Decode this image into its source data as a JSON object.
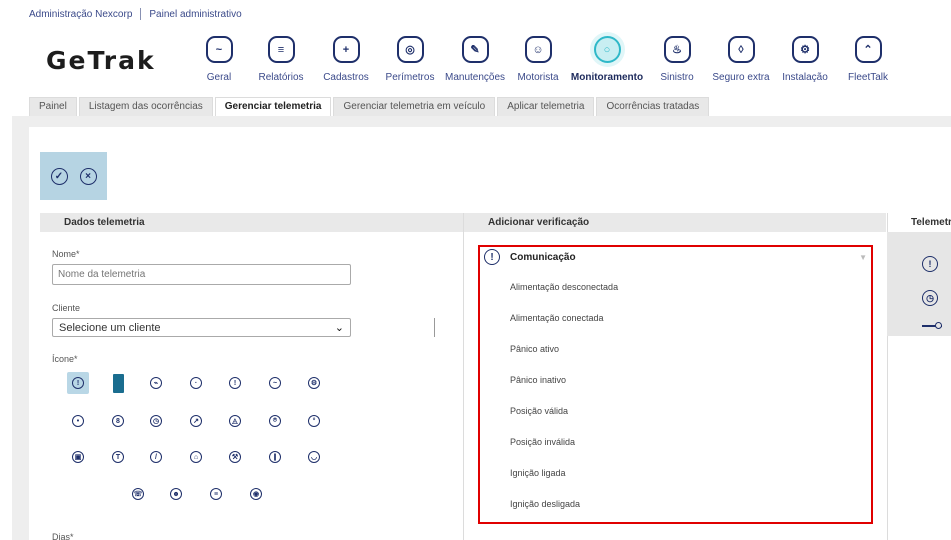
{
  "breadcrumb": {
    "org": "Administração Nexcorp",
    "section": "Painel administrativo"
  },
  "logo": "GeTrak",
  "modules": [
    {
      "label": "Geral",
      "icon": "chart-icon",
      "glyph": "~"
    },
    {
      "label": "Relatórios",
      "icon": "report-icon",
      "glyph": "≡"
    },
    {
      "label": "Cadastros",
      "icon": "folder-add-icon",
      "glyph": "+"
    },
    {
      "label": "Perímetros",
      "icon": "target-icon",
      "glyph": "◎"
    },
    {
      "label": "Manutenções",
      "icon": "wrench-icon",
      "glyph": "✎"
    },
    {
      "label": "Motorista",
      "icon": "driver-icon",
      "glyph": "☺"
    },
    {
      "label": "Monitoramento",
      "icon": "monitoring-icon",
      "glyph": "○",
      "active": true
    },
    {
      "label": "Sinistro",
      "icon": "siren-icon",
      "glyph": "♨"
    },
    {
      "label": "Seguro extra",
      "icon": "shield-keyhole-icon",
      "glyph": "◊"
    },
    {
      "label": "Instalação",
      "icon": "installer-icon",
      "glyph": "⚙"
    },
    {
      "label": "FleetTalk",
      "icon": "fleettalk-icon",
      "glyph": "⌃"
    }
  ],
  "tabs": [
    {
      "label": "Painel"
    },
    {
      "label": "Listagem das ocorrências"
    },
    {
      "label": "Gerenciar telemetria",
      "active": true
    },
    {
      "label": "Gerenciar telemetria em veículo"
    },
    {
      "label": "Aplicar telemetria"
    },
    {
      "label": "Ocorrências tratadas"
    }
  ],
  "actions": {
    "confirm_icon": "check-icon",
    "cancel_icon": "close-icon"
  },
  "sections": {
    "dados": "Dados telemetria",
    "verificacao": "Adicionar verificação",
    "telemetria": "Telemetri"
  },
  "form": {
    "nome_label": "Nome*",
    "nome_placeholder": "Nome da telemetria",
    "cliente_label": "Cliente",
    "cliente_selected": "Selecione um cliente",
    "icone_label": "Ícone*",
    "dias_label": "Dias*"
  },
  "icon_grid": [
    {
      "name": "alert-icon",
      "glyph": "!",
      "selected": true
    },
    {
      "name": "battery-icon",
      "glyph": "",
      "solid": true
    },
    {
      "name": "plug-icon",
      "glyph": "⌁"
    },
    {
      "name": "timer-icon",
      "glyph": "·"
    },
    {
      "name": "warning-icon",
      "glyph": "!"
    },
    {
      "name": "gauge-icon",
      "glyph": "~"
    },
    {
      "name": "settings-icon",
      "glyph": "⚙"
    },
    {
      "name": "target-icon",
      "glyph": "•"
    },
    {
      "name": "key-icon",
      "glyph": "8"
    },
    {
      "name": "clock-icon",
      "glyph": "◷"
    },
    {
      "name": "speedometer-icon",
      "glyph": "↗"
    },
    {
      "name": "shield-icon",
      "glyph": "◬"
    },
    {
      "name": "location-icon",
      "glyph": "⌾"
    },
    {
      "name": "temperature-icon",
      "glyph": "°"
    },
    {
      "name": "fuel-icon",
      "glyph": "▣"
    },
    {
      "name": "thermometer-icon",
      "glyph": "T"
    },
    {
      "name": "pen-icon",
      "glyph": "/"
    },
    {
      "name": "home-icon",
      "glyph": "⌂"
    },
    {
      "name": "tool-icon",
      "glyph": "⚒"
    },
    {
      "name": "clip-icon",
      "glyph": "∥"
    },
    {
      "name": "steering-icon",
      "glyph": "◡"
    },
    {
      "name": "phone-icon",
      "glyph": "☏"
    },
    {
      "name": "person-icon",
      "glyph": "☻"
    },
    {
      "name": "message-icon",
      "glyph": "≡"
    },
    {
      "name": "camera-icon",
      "glyph": "◉"
    }
  ],
  "dropdown": {
    "title": "Comunicação",
    "header_icon": "alert-icon",
    "items": [
      "Alimentação desconectada",
      "Alimentação conectada",
      "Pânico ativo",
      "Pânico inativo",
      "Posição válida",
      "Posição inválida",
      "Ignição ligada",
      "Ignição desligada"
    ]
  },
  "right_panel_icons": [
    "alert-icon",
    "clock-icon",
    "key-icon"
  ],
  "colors": {
    "accent": "#2fb8c8",
    "navy": "#1e2f6a",
    "highlight": "#e00000",
    "action_bg": "#b6d4e3"
  }
}
